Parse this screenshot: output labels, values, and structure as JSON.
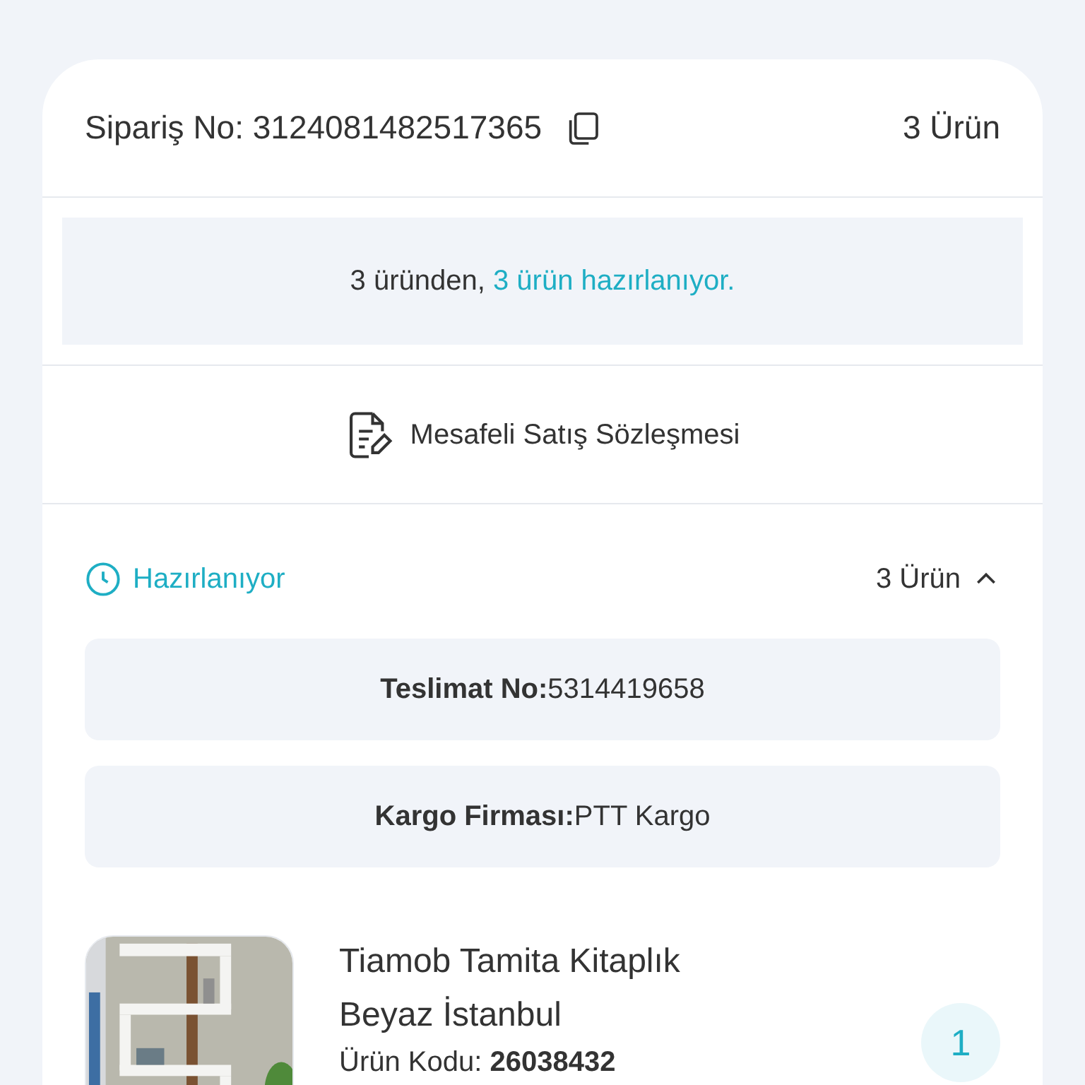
{
  "order": {
    "label": "Sipariş No:",
    "number": "3124081482517365",
    "item_count": "3 Ürün"
  },
  "summary": {
    "prefix": "3 üründen,",
    "highlight": "3 ürün hazırlanıyor."
  },
  "contract": {
    "label": "Mesafeli Satış Sözleşmesi"
  },
  "shipment": {
    "status": "Hazırlanıyor",
    "item_count": "3 Ürün",
    "expanded": true,
    "info": [
      {
        "label": "Teslimat No:",
        "value": "5314419658"
      },
      {
        "label": "Kargo Firması:",
        "value": "PTT Kargo"
      }
    ],
    "products": [
      {
        "name": "Tiamob Tamita Kitaplık Beyaz İstanbul",
        "code_label": "Ürün Kodu:",
        "code": "26038432",
        "quantity": "1"
      }
    ]
  }
}
